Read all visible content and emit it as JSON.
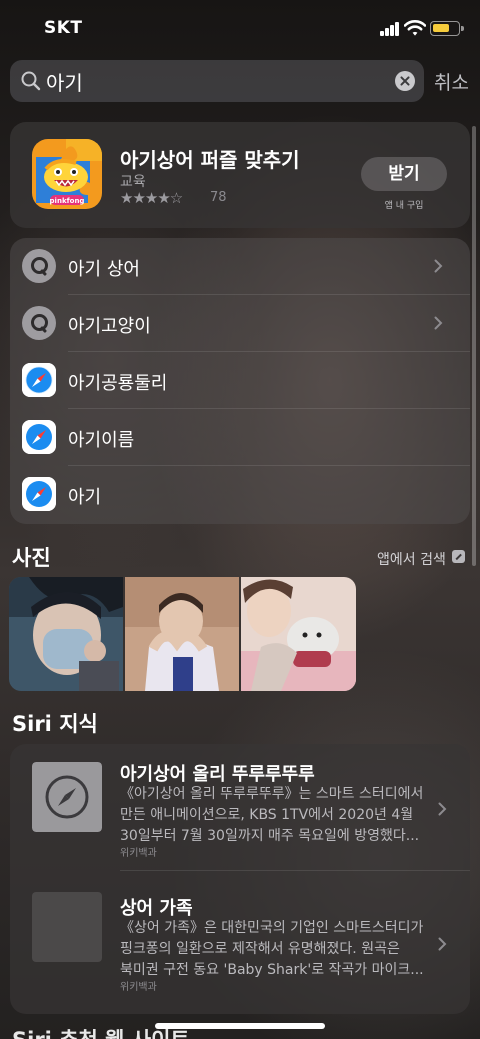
{
  "status_bar": {
    "carrier": "SKT",
    "battery_color": "#f6cc3c"
  },
  "search": {
    "query": "아기",
    "cancel_label": "취소"
  },
  "app_result": {
    "title": "아기상어 퍼즐 맞추기",
    "category": "교육",
    "stars_text": "★★★★☆",
    "rating_fraction": 0.9,
    "rating_count": "78",
    "get_label": "받기",
    "in_app_purchase": "앱 내 구입",
    "icon_brand": "pinkfong"
  },
  "suggestions": [
    {
      "label": "아기 상어",
      "icon": "search-icon",
      "chevron": true
    },
    {
      "label": "아기고양이",
      "icon": "search-icon",
      "chevron": true
    },
    {
      "label": "아기공룡둘리",
      "icon": "safari-icon",
      "chevron": false
    },
    {
      "label": "아기이름",
      "icon": "safari-icon",
      "chevron": false
    },
    {
      "label": "아기",
      "icon": "safari-icon",
      "chevron": false
    }
  ],
  "photos_section": {
    "title": "사진",
    "search_in_app": "앱에서 검색",
    "photo_count": 3
  },
  "siri_section": {
    "title": "Siri 지식",
    "items": [
      {
        "title": "아기상어 올리 뚜루루뚜루",
        "lines": [
          "《아기상어 올리 뚜루루뚜루》는 스마트 스터디에서",
          "만든 애니메이션으로, KBS 1TV에서 2020년 4월",
          "30일부터 7월 30일까지 매주 목요일에 방영했다..."
        ],
        "source": "위키백과",
        "thumb_icon": "safari-compass-icon"
      },
      {
        "title": "상어 가족",
        "lines": [
          "《상어 가족》은 대한민국의 기업인 스마트스터디가",
          "핑크퐁의 일환으로 제작해서 유명해졌다. 원곡은",
          "북미권 구전 동요 'Baby Shark'로 작곡가 마이크..."
        ],
        "source": "위키백과",
        "thumb_icon": "placeholder-thumbnail"
      }
    ]
  },
  "next_section_title_partial": "Siri 추천 웹 사이트"
}
